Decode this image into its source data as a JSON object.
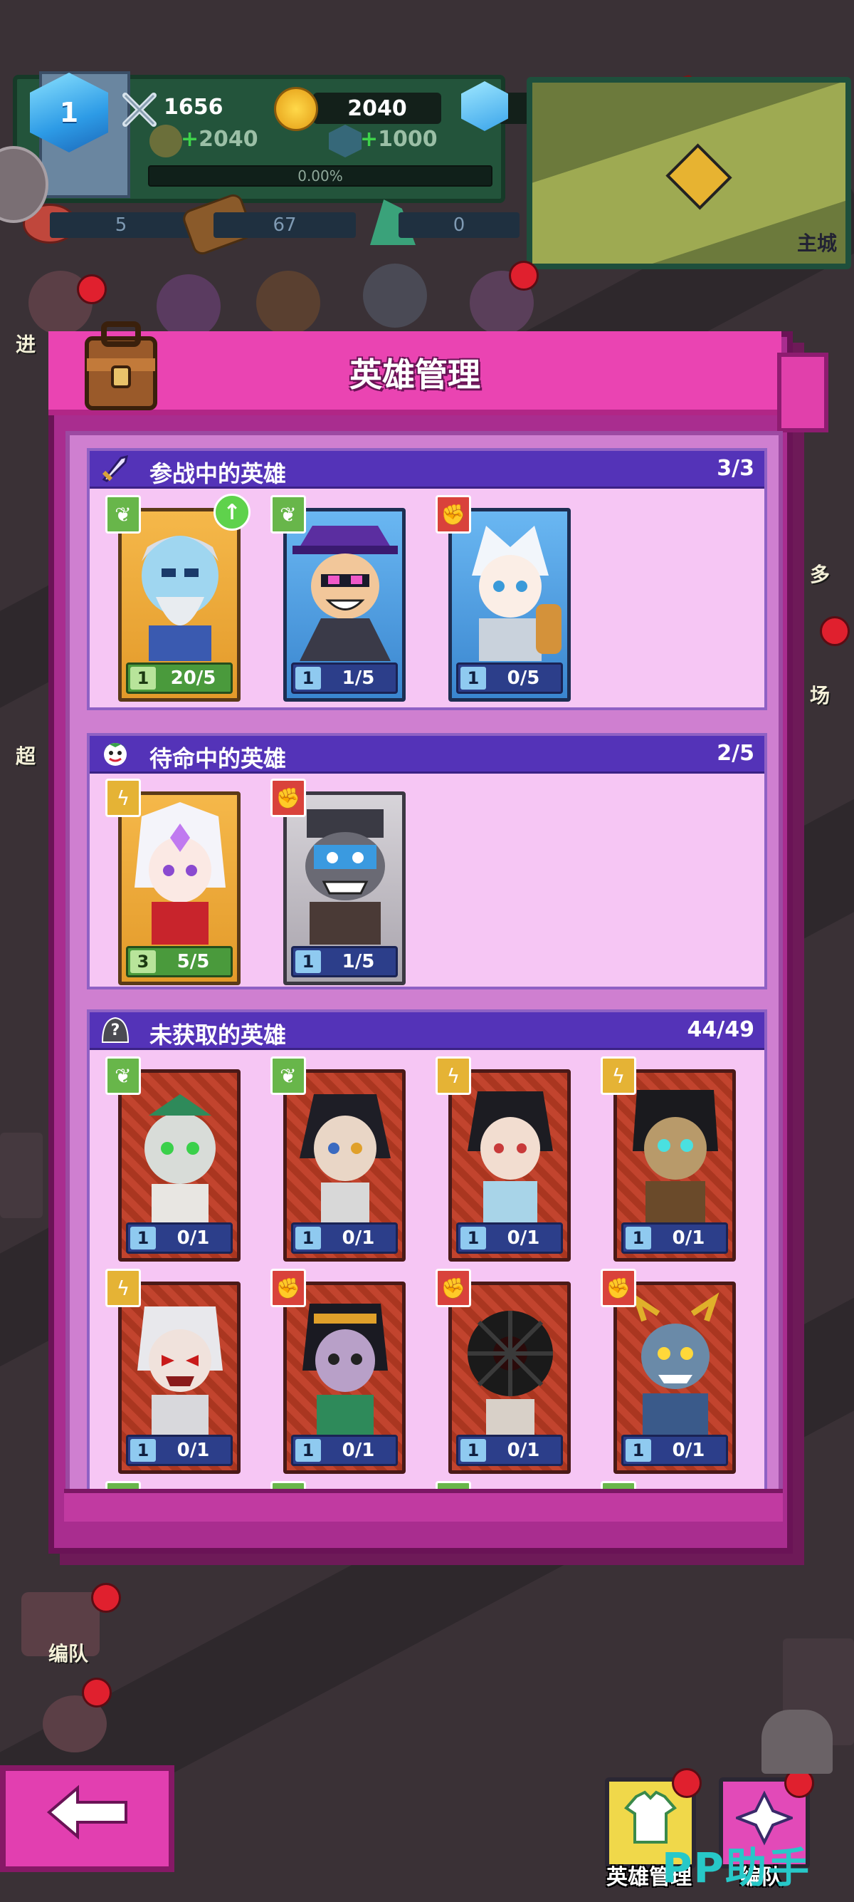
{
  "hud": {
    "level": "1",
    "power": "1656",
    "gold": "2040",
    "gems": "1000",
    "tickets": "0",
    "gold_income": "2040",
    "gem_income": "1000",
    "progress": "0.00%",
    "resources": [
      "5",
      "67",
      "0"
    ],
    "minimap_label": "主城"
  },
  "side_menu": {
    "labels": [
      "进",
      "超",
      "多",
      "场"
    ],
    "formation_label": "编队"
  },
  "dialog": {
    "title": "英雄管理",
    "sections": [
      {
        "title": "参战中的英雄",
        "count": "3/3",
        "heroes": [
          {
            "element": "leaf",
            "level": "1",
            "fragments": "20/5",
            "rarity": "gold",
            "upgrade": true
          },
          {
            "element": "leaf",
            "level": "1",
            "fragments": "1/5",
            "rarity": "blue",
            "upgrade": false
          },
          {
            "element": "fist",
            "level": "1",
            "fragments": "0/5",
            "rarity": "blue",
            "upgrade": false
          }
        ]
      },
      {
        "title": "待命中的英雄",
        "count": "2/5",
        "heroes": [
          {
            "element": "bolt",
            "level": "3",
            "fragments": "5/5",
            "rarity": "gold",
            "upgrade": false
          },
          {
            "element": "fist",
            "level": "1",
            "fragments": "1/5",
            "rarity": "grey",
            "upgrade": false
          }
        ]
      },
      {
        "title": "未获取的英雄",
        "count": "44/49",
        "heroes": [
          {
            "element": "leaf",
            "level": "1",
            "fragments": "0/1",
            "rarity": "red"
          },
          {
            "element": "leaf",
            "level": "1",
            "fragments": "0/1",
            "rarity": "red"
          },
          {
            "element": "bolt",
            "level": "1",
            "fragments": "0/1",
            "rarity": "red"
          },
          {
            "element": "bolt",
            "level": "1",
            "fragments": "0/1",
            "rarity": "red"
          },
          {
            "element": "bolt",
            "level": "1",
            "fragments": "0/1",
            "rarity": "red"
          },
          {
            "element": "fist",
            "level": "1",
            "fragments": "0/1",
            "rarity": "red"
          },
          {
            "element": "fist",
            "level": "1",
            "fragments": "0/1",
            "rarity": "red"
          },
          {
            "element": "fist",
            "level": "1",
            "fragments": "0/1",
            "rarity": "red"
          }
        ]
      }
    ]
  },
  "bottom_nav": {
    "hero_manage": "英雄管理",
    "formation": "编队"
  },
  "watermark": "PP助手",
  "colors": {
    "dialog": "#ea44b2",
    "section_header": "#5433b8",
    "leaf": "#68b64a",
    "fist": "#d9423b",
    "bolt": "#e5b335"
  }
}
